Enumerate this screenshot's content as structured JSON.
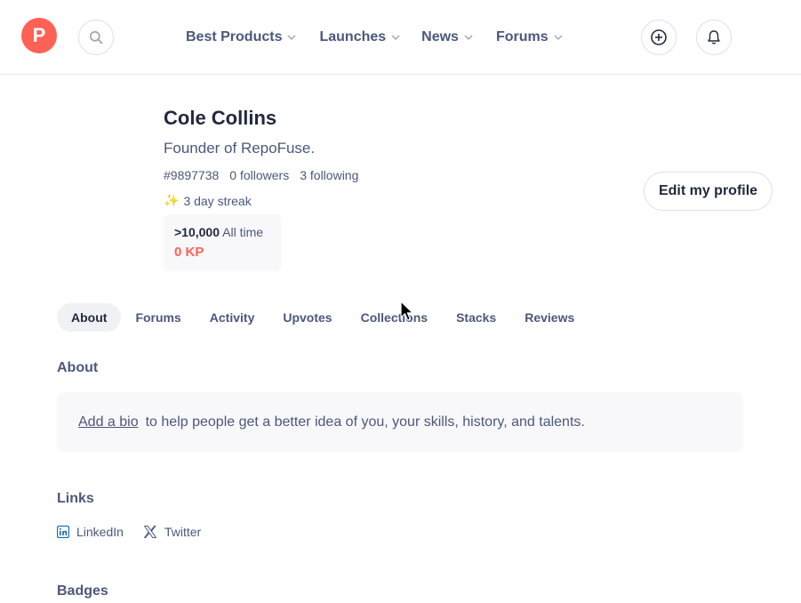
{
  "header": {
    "logo_letter": "P",
    "nav": [
      {
        "label": "Best Products"
      },
      {
        "label": "Launches"
      },
      {
        "label": "News"
      },
      {
        "label": "Forums"
      }
    ]
  },
  "profile": {
    "name": "Cole Collins",
    "headline": "Founder of RepoFuse.",
    "user_id": "#9897738",
    "followers": "0 followers",
    "following": "3 following",
    "streak": "3 day streak",
    "rank_value": ">10,000",
    "rank_label": "All time",
    "kp": "0 KP",
    "edit_button": "Edit my profile"
  },
  "tabs": [
    "About",
    "Forums",
    "Activity",
    "Upvotes",
    "Collections",
    "Stacks",
    "Reviews"
  ],
  "about": {
    "title": "About",
    "add_bio": "Add a bio",
    "bio_prompt": "to help people get a better idea of you, your skills, history, and talents."
  },
  "links_section": {
    "title": "Links",
    "items": [
      {
        "label": "LinkedIn",
        "icon": "linkedin-icon"
      },
      {
        "label": "Twitter",
        "icon": "x-icon"
      }
    ]
  },
  "badges_section": {
    "title": "Badges"
  },
  "colors": {
    "brand": "#ff6154",
    "text": "#21293c",
    "muted": "#4b587c"
  }
}
